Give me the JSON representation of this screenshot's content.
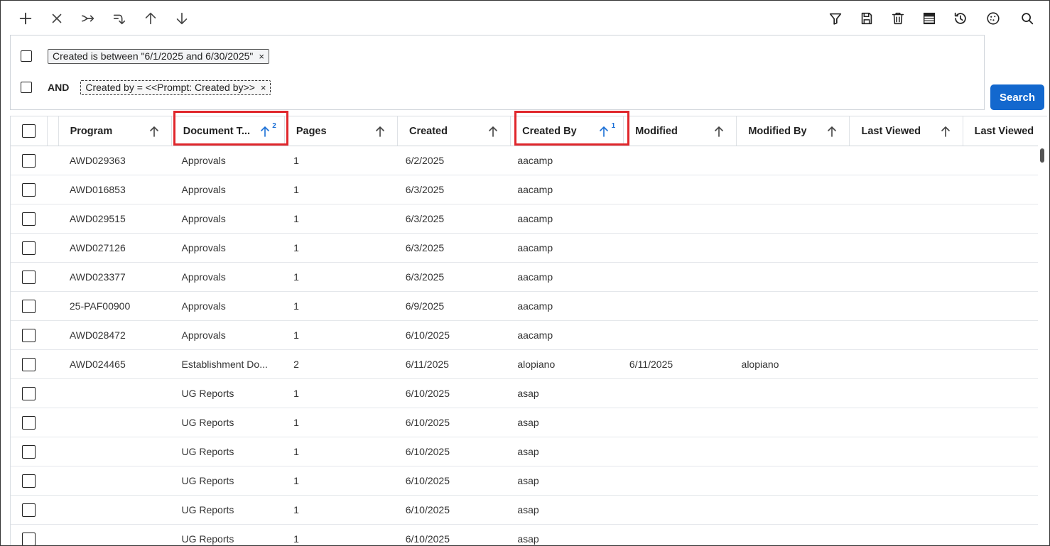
{
  "toolbar": {
    "left_icons": [
      "add-icon",
      "close-icon",
      "merge-icon",
      "reorder-icon",
      "arrow-up-icon",
      "arrow-down-icon"
    ],
    "right_icons": [
      "filter-icon",
      "save-icon",
      "delete-icon",
      "columns-icon",
      "history-icon",
      "cookie-icon",
      "search-icon"
    ]
  },
  "filters": {
    "rows": [
      {
        "operator": "",
        "text": "Created is between \"6/1/2025 and 6/30/2025\"",
        "style": "solid"
      },
      {
        "operator": "AND",
        "text": "Created by = <<Prompt: Created by>>",
        "style": "dashed"
      }
    ],
    "remove_glyph": "×"
  },
  "search_button": {
    "label": "Search",
    "color": "#1368ce"
  },
  "grid": {
    "columns": [
      {
        "key": "program",
        "label": "Program",
        "sort_order": ""
      },
      {
        "key": "doc_type",
        "label": "Document T...",
        "sort_order": "2"
      },
      {
        "key": "pages",
        "label": "Pages",
        "sort_order": ""
      },
      {
        "key": "created",
        "label": "Created",
        "sort_order": ""
      },
      {
        "key": "created_by",
        "label": "Created By",
        "sort_order": "1"
      },
      {
        "key": "modified",
        "label": "Modified",
        "sort_order": ""
      },
      {
        "key": "modified_by",
        "label": "Modified By",
        "sort_order": ""
      },
      {
        "key": "last_viewed",
        "label": "Last Viewed",
        "sort_order": ""
      },
      {
        "key": "last_viewed_2",
        "label": "Last Viewed",
        "sort_order": ""
      }
    ],
    "rows": [
      {
        "program": "AWD029363",
        "doc_type": "Approvals",
        "pages": "1",
        "created": "6/2/2025",
        "created_by": "aacamp",
        "modified": "",
        "modified_by": ""
      },
      {
        "program": "AWD016853",
        "doc_type": "Approvals",
        "pages": "1",
        "created": "6/3/2025",
        "created_by": "aacamp",
        "modified": "",
        "modified_by": ""
      },
      {
        "program": "AWD029515",
        "doc_type": "Approvals",
        "pages": "1",
        "created": "6/3/2025",
        "created_by": "aacamp",
        "modified": "",
        "modified_by": ""
      },
      {
        "program": "AWD027126",
        "doc_type": "Approvals",
        "pages": "1",
        "created": "6/3/2025",
        "created_by": "aacamp",
        "modified": "",
        "modified_by": ""
      },
      {
        "program": "AWD023377",
        "doc_type": "Approvals",
        "pages": "1",
        "created": "6/3/2025",
        "created_by": "aacamp",
        "modified": "",
        "modified_by": ""
      },
      {
        "program": "25-PAF00900",
        "doc_type": "Approvals",
        "pages": "1",
        "created": "6/9/2025",
        "created_by": "aacamp",
        "modified": "",
        "modified_by": ""
      },
      {
        "program": "AWD028472",
        "doc_type": "Approvals",
        "pages": "1",
        "created": "6/10/2025",
        "created_by": "aacamp",
        "modified": "",
        "modified_by": ""
      },
      {
        "program": "AWD024465",
        "doc_type": "Establishment Do...",
        "pages": "2",
        "created": "6/11/2025",
        "created_by": "alopiano",
        "modified": "6/11/2025",
        "modified_by": "alopiano"
      },
      {
        "program": "",
        "doc_type": "UG Reports",
        "pages": "1",
        "created": "6/10/2025",
        "created_by": "asap",
        "modified": "",
        "modified_by": ""
      },
      {
        "program": "",
        "doc_type": "UG Reports",
        "pages": "1",
        "created": "6/10/2025",
        "created_by": "asap",
        "modified": "",
        "modified_by": ""
      },
      {
        "program": "",
        "doc_type": "UG Reports",
        "pages": "1",
        "created": "6/10/2025",
        "created_by": "asap",
        "modified": "",
        "modified_by": ""
      },
      {
        "program": "",
        "doc_type": "UG Reports",
        "pages": "1",
        "created": "6/10/2025",
        "created_by": "asap",
        "modified": "",
        "modified_by": ""
      },
      {
        "program": "",
        "doc_type": "UG Reports",
        "pages": "1",
        "created": "6/10/2025",
        "created_by": "asap",
        "modified": "",
        "modified_by": ""
      },
      {
        "program": "",
        "doc_type": "UG Reports",
        "pages": "1",
        "created": "6/10/2025",
        "created_by": "asap",
        "modified": "",
        "modified_by": ""
      }
    ]
  },
  "highlighted_columns": [
    "doc_type",
    "created_by"
  ],
  "colors": {
    "highlight": "#e0262b",
    "sort_active": "#1a6fd6",
    "primary": "#1368ce"
  }
}
